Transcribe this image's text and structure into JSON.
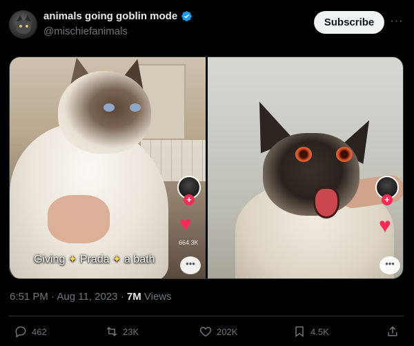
{
  "account": {
    "display_name": "animals going goblin mode",
    "handle": "@mischiefanimals",
    "verified": true,
    "verified_color": "#1d9bf0"
  },
  "buttons": {
    "subscribe": "Subscribe",
    "more": "···"
  },
  "media": {
    "left": {
      "caption_word_1": "Giving",
      "caption_word_2": "Prada",
      "caption_word_3": "a bath",
      "like_count": "664.3K"
    },
    "right": {}
  },
  "tweet_meta": {
    "time": "6:51 PM",
    "separator": "·",
    "date": "Aug 11, 2023",
    "views_count": "7M",
    "views_label": "Views"
  },
  "actions": {
    "replies": "462",
    "reposts": "23K",
    "likes": "202K",
    "bookmarks": "4.5K"
  },
  "icons": {
    "reply": "reply-icon",
    "repost": "repost-icon",
    "like": "heart-icon",
    "bookmark": "bookmark-icon",
    "share": "share-icon"
  },
  "colors": {
    "background": "#000000",
    "text_primary": "#e7e9ea",
    "text_secondary": "#71767b",
    "tiktok_red": "#fe2c55"
  }
}
